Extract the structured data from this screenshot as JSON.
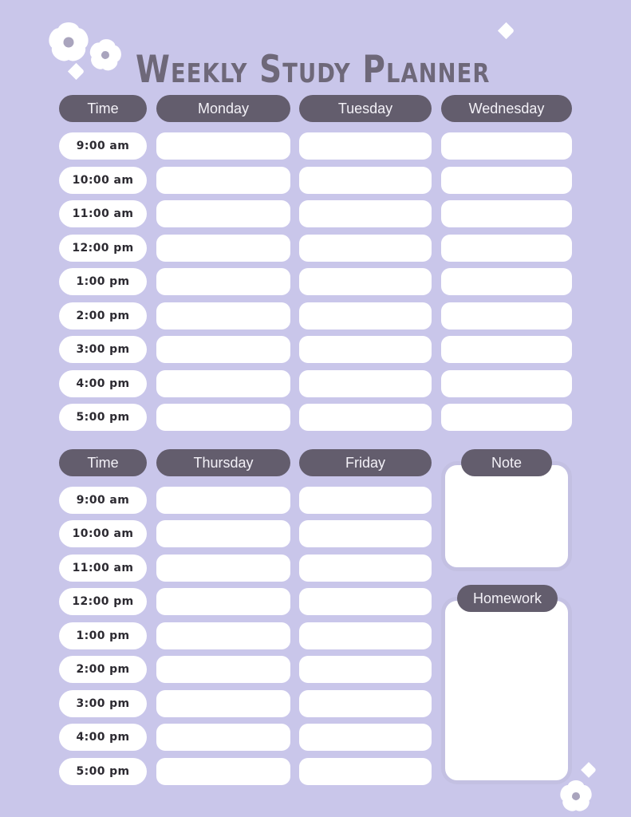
{
  "page": {
    "title": "Weekly Study Planner",
    "background_color": "#c9c6ea",
    "accent_color": "#635d6d",
    "title_color": "#6e6879",
    "panel_border_color": "#c3c0e2"
  },
  "sections": [
    {
      "name": "first-half-week",
      "headers": [
        "Time",
        "Monday",
        "Tuesday",
        "Wednesday"
      ],
      "times": [
        "9:00 am",
        "10:00 am",
        "11:00 am",
        "12:00 pm",
        "1:00 pm",
        "2:00 pm",
        "3:00 pm",
        "4:00 pm",
        "5:00 pm"
      ],
      "entries": {
        "Monday": [
          "",
          "",
          "",
          "",
          "",
          "",
          "",
          "",
          ""
        ],
        "Tuesday": [
          "",
          "",
          "",
          "",
          "",
          "",
          "",
          "",
          ""
        ],
        "Wednesday": [
          "",
          "",
          "",
          "",
          "",
          "",
          "",
          "",
          ""
        ]
      }
    },
    {
      "name": "second-half-week",
      "headers": [
        "Time",
        "Thursday",
        "Friday"
      ],
      "times": [
        "9:00 am",
        "10:00 am",
        "11:00 am",
        "12:00 pm",
        "1:00 pm",
        "2:00 pm",
        "3:00 pm",
        "4:00 pm",
        "5:00 pm"
      ],
      "entries": {
        "Thursday": [
          "",
          "",
          "",
          "",
          "",
          "",
          "",
          "",
          ""
        ],
        "Friday": [
          "",
          "",
          "",
          "",
          "",
          "",
          "",
          "",
          ""
        ]
      }
    }
  ],
  "panels": [
    {
      "name": "note",
      "label": "Note",
      "content": ""
    },
    {
      "name": "homework",
      "label": "Homework",
      "content": ""
    }
  ],
  "decorations": [
    {
      "name": "flower-large-top-left",
      "type": "flower"
    },
    {
      "name": "flower-small-top-left",
      "type": "flower"
    },
    {
      "name": "heart-top-left",
      "type": "heart"
    },
    {
      "name": "heart-title-right",
      "type": "heart"
    },
    {
      "name": "heart-bottom-right",
      "type": "heart"
    },
    {
      "name": "flower-bottom-right",
      "type": "flower"
    }
  ]
}
